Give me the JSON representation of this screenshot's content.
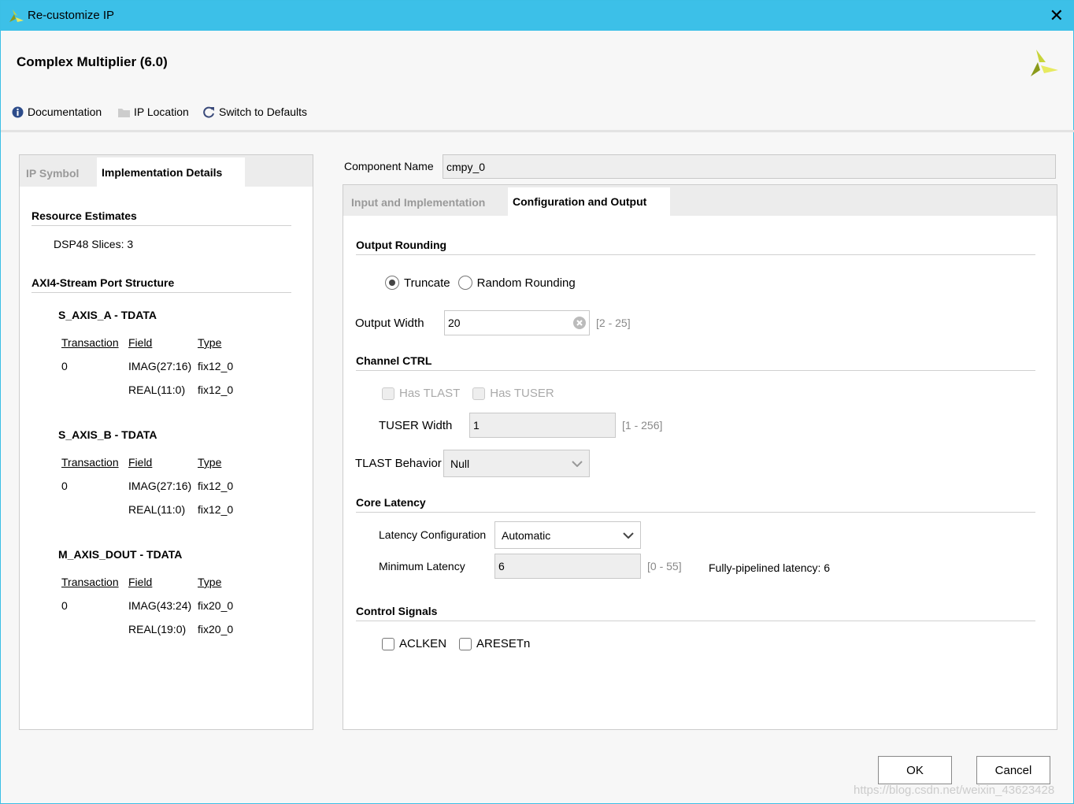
{
  "window": {
    "title": "Re-customize IP",
    "close": "✕"
  },
  "header": {
    "title": "Complex Multiplier (6.0)"
  },
  "toolbar": {
    "documentation": "Documentation",
    "ip_location": "IP Location",
    "switch_defaults": "Switch to Defaults"
  },
  "left": {
    "tabs": [
      "IP Symbol",
      "Implementation Details"
    ],
    "resource_title": "Resource Estimates",
    "dsp": "DSP48 Slices: 3",
    "axi_title": "AXI4-Stream Port Structure",
    "headers": [
      "Transaction",
      "Field",
      "Type"
    ],
    "ports": [
      {
        "name": "S_AXIS_A - TDATA",
        "rows": [
          [
            "0",
            "IMAG(27:16)",
            "fix12_0"
          ],
          [
            "",
            "REAL(11:0)",
            "fix12_0"
          ]
        ]
      },
      {
        "name": "S_AXIS_B - TDATA",
        "rows": [
          [
            "0",
            "IMAG(27:16)",
            "fix12_0"
          ],
          [
            "",
            "REAL(11:0)",
            "fix12_0"
          ]
        ]
      },
      {
        "name": "M_AXIS_DOUT - TDATA",
        "rows": [
          [
            "0",
            "IMAG(43:24)",
            "fix20_0"
          ],
          [
            "",
            "REAL(19:0)",
            "fix20_0"
          ]
        ]
      }
    ]
  },
  "right": {
    "component_label": "Component Name",
    "component_value": "cmpy_0",
    "tabs": [
      "Input and Implementation",
      "Configuration and Output"
    ],
    "output_rounding": {
      "title": "Output Rounding",
      "options": [
        "Truncate",
        "Random Rounding"
      ],
      "selected": "Truncate",
      "width_label": "Output Width",
      "width_value": "20",
      "width_range": "[2 - 25]"
    },
    "channel": {
      "title": "Channel CTRL",
      "has_tlast": "Has TLAST",
      "has_tuser": "Has TUSER",
      "tuser_label": "TUSER Width",
      "tuser_value": "1",
      "tuser_range": "[1 - 256]",
      "tlast_label": "TLAST Behavior",
      "tlast_value": "Null"
    },
    "latency": {
      "title": "Core Latency",
      "config_label": "Latency Configuration",
      "config_value": "Automatic",
      "min_label": "Minimum Latency",
      "min_value": "6",
      "min_range": "[0 - 55]",
      "pipelined": "Fully-pipelined latency: 6"
    },
    "control": {
      "title": "Control Signals",
      "aclken": "ACLKEN",
      "aresetn": "ARESETn"
    }
  },
  "buttons": {
    "ok": "OK",
    "cancel": "Cancel"
  },
  "watermark": "https://blog.csdn.net/weixin_43623428"
}
